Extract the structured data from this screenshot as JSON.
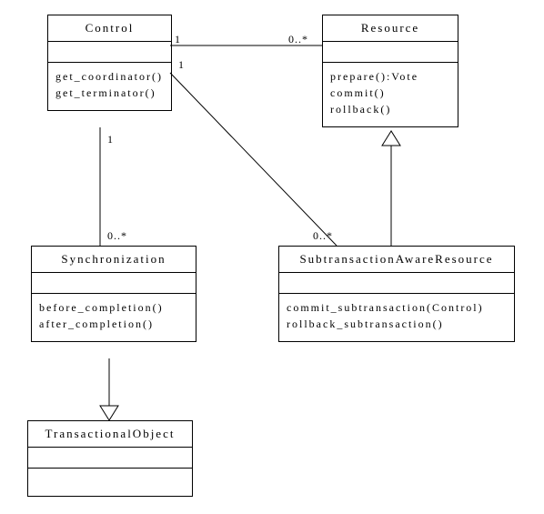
{
  "chart_data": {
    "type": "uml-class-diagram",
    "classes": [
      {
        "id": "Control",
        "name": "Control",
        "operations": [
          "get_coordinator()",
          "get_terminator()"
        ]
      },
      {
        "id": "Resource",
        "name": "Resource",
        "operations": [
          "prepare():Vote",
          "commit()",
          "rollback()"
        ]
      },
      {
        "id": "Synchronization",
        "name": "Synchronization",
        "operations": [
          "before_completion()",
          "after_completion()"
        ]
      },
      {
        "id": "SubtransactionAwareResource",
        "name": "SubtransactionAwareResource",
        "operations": [
          "commit_subtransaction(Control)",
          "rollback_subtransaction()"
        ]
      },
      {
        "id": "TransactionalObject",
        "name": "TransactionalObject",
        "operations": []
      }
    ],
    "relationships": [
      {
        "from": "Control",
        "to": "Resource",
        "type": "association",
        "from_mult": "1",
        "to_mult": "0..*"
      },
      {
        "from": "Control",
        "to": "SubtransactionAwareResource",
        "type": "association",
        "from_mult": "1",
        "to_mult": "0..*"
      },
      {
        "from": "Control",
        "to": "Synchronization",
        "type": "association",
        "from_mult": "1",
        "to_mult": "0..*"
      },
      {
        "from": "SubtransactionAwareResource",
        "to": "Resource",
        "type": "generalization"
      },
      {
        "from": "Synchronization",
        "to": "TransactionalObject",
        "type": "generalization"
      }
    ]
  },
  "boxes": {
    "control": {
      "name": "Control",
      "op1": "get_coordinator()",
      "op2": "get_terminator()"
    },
    "resource": {
      "name": "Resource",
      "op1": "prepare():Vote",
      "op2": "commit()",
      "op3": "rollback()"
    },
    "sync": {
      "name": "Synchronization",
      "op1": "before_completion()",
      "op2": "after_completion()"
    },
    "subtx": {
      "name": "SubtransactionAwareResource",
      "op1": "commit_subtransaction(Control)",
      "op2": "rollback_subtransaction()"
    },
    "txobj": {
      "name": "TransactionalObject"
    }
  },
  "mult": {
    "ctrl_res_left": "1",
    "ctrl_res_right": "0..*",
    "ctrl_sub_top": "1",
    "ctrl_sub_bottom": "0..*",
    "ctrl_sync_top": "1",
    "ctrl_sync_bottom": "0..*"
  }
}
